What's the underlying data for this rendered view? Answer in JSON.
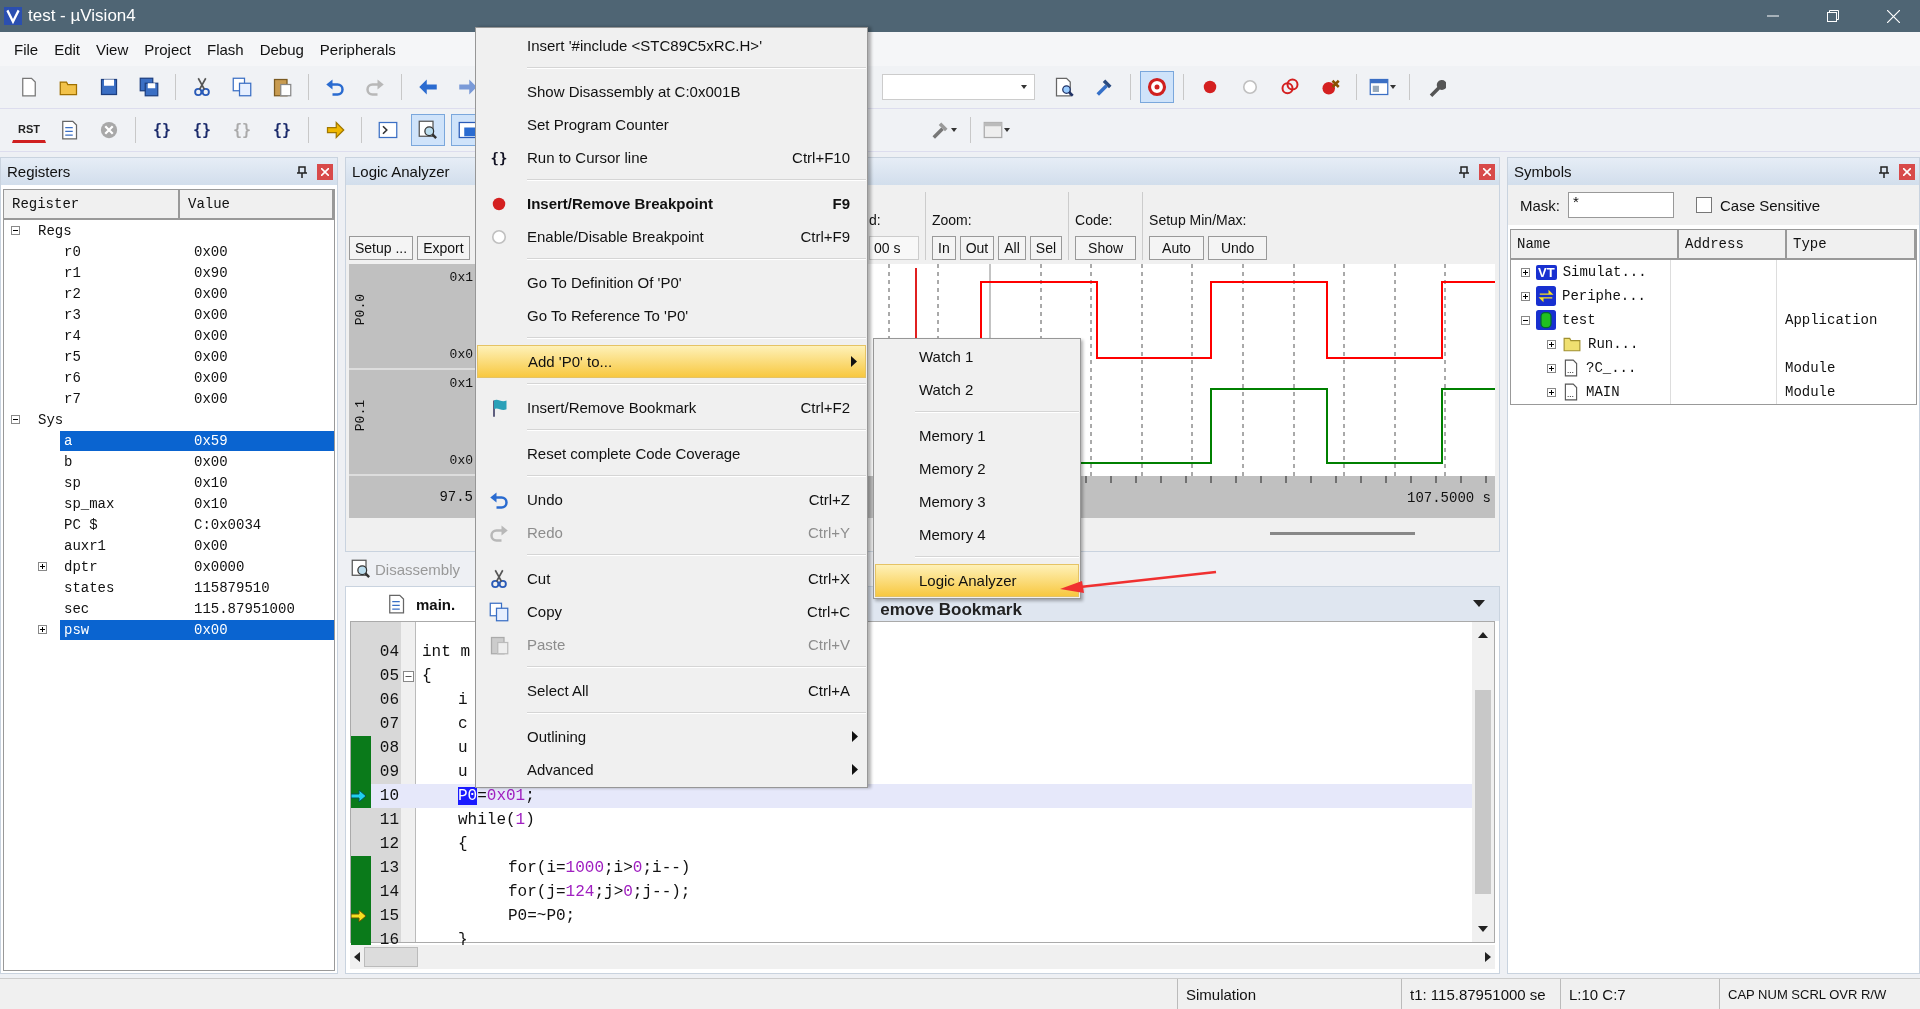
{
  "window": {
    "title": "test  - µVision4"
  },
  "menu_bar": [
    "File",
    "Edit",
    "View",
    "Project",
    "Flash",
    "Debug",
    "Peripherals"
  ],
  "debug_toolbar": {
    "reset_label": "RST",
    "step_glyphs": [
      "{}",
      "{}",
      "{}",
      "{}"
    ]
  },
  "registers": {
    "title": "Registers",
    "columns": [
      "Register",
      "Value"
    ],
    "groups": [
      {
        "name": "Regs",
        "expanded": true,
        "children": [
          {
            "name": "r0",
            "value": "0x00",
            "kind": "leaf",
            "selected": false
          },
          {
            "name": "r1",
            "value": "0x90",
            "kind": "leaf",
            "selected": false
          },
          {
            "name": "r2",
            "value": "0x00",
            "kind": "leaf",
            "selected": false
          },
          {
            "name": "r3",
            "value": "0x00",
            "kind": "leaf",
            "selected": false
          },
          {
            "name": "r4",
            "value": "0x00",
            "kind": "leaf",
            "selected": false
          },
          {
            "name": "r5",
            "value": "0x00",
            "kind": "leaf",
            "selected": false
          },
          {
            "name": "r6",
            "value": "0x00",
            "kind": "leaf",
            "selected": false
          },
          {
            "name": "r7",
            "value": "0x00",
            "kind": "leaf",
            "selected": false
          }
        ]
      },
      {
        "name": "Sys",
        "expanded": true,
        "children": [
          {
            "name": "a",
            "value": "0x59",
            "kind": "leaf",
            "selected": true
          },
          {
            "name": "b",
            "value": "0x00",
            "kind": "leaf",
            "selected": false
          },
          {
            "name": "sp",
            "value": "0x10",
            "kind": "leaf",
            "selected": false
          },
          {
            "name": "sp_max",
            "value": "0x10",
            "kind": "leaf",
            "selected": false
          },
          {
            "name": "PC  $",
            "value": "C:0x0034",
            "kind": "leaf",
            "selected": false
          },
          {
            "name": "auxr1",
            "value": "0x00",
            "kind": "leaf",
            "selected": false
          },
          {
            "name": "dptr",
            "value": "0x0000",
            "kind": "collapsed",
            "selected": false
          },
          {
            "name": "states",
            "value": "115879510",
            "kind": "leaf",
            "selected": false
          },
          {
            "name": "sec",
            "value": "115.87951000",
            "kind": "leaf",
            "selected": false
          },
          {
            "name": "psw",
            "value": "0x00",
            "kind": "collapsed",
            "selected": true
          }
        ]
      }
    ]
  },
  "logic_analyzer": {
    "title": "Logic Analyzer",
    "buttons": [
      "Setup ...",
      "Export"
    ],
    "range_label": "d:",
    "range_value": "00 s",
    "zoom_label": "Zoom:",
    "zoom_buttons": [
      "In",
      "Out",
      "All",
      "Sel"
    ],
    "code_label": "Code:",
    "code_buttons": [
      "Show"
    ],
    "minmax_label": "Setup Min/Max:",
    "minmax_buttons": [
      "Auto",
      "Undo"
    ],
    "signals": [
      {
        "name": "P0.0",
        "max": "0x1",
        "min": "0x0",
        "color": "#ff0000"
      },
      {
        "name": "P0.1",
        "max": "0x1",
        "min": "0x0",
        "color": "#008000"
      }
    ],
    "time_start": "97.5",
    "time_end": "107.5000 s"
  },
  "editor": {
    "tabs": [
      {
        "label": "Disassembly",
        "selected": false
      },
      {
        "label": "main.",
        "selected": true
      }
    ],
    "tooltip_fragment": "emove Bookmark",
    "lines": [
      {
        "number": "04",
        "kind": "top",
        "covered": false,
        "cursor_arrow": false,
        "pc_arrow": false,
        "segments": [
          {
            "text": "int m",
            "kind": "plain"
          }
        ]
      },
      {
        "number": "05",
        "kind": "top",
        "covered": false,
        "cursor_arrow": false,
        "pc_arrow": false,
        "fold": true,
        "segments": [
          {
            "text": "{",
            "kind": "plain"
          }
        ]
      },
      {
        "number": "06",
        "kind": "body",
        "covered": false,
        "cursor_arrow": false,
        "pc_arrow": false,
        "segments": [
          {
            "text": "i",
            "kind": "plain"
          }
        ]
      },
      {
        "number": "07",
        "kind": "body",
        "covered": false,
        "cursor_arrow": false,
        "pc_arrow": false,
        "segments": [
          {
            "text": "c",
            "kind": "plain"
          }
        ]
      },
      {
        "number": "08",
        "kind": "body",
        "covered": true,
        "cursor_arrow": false,
        "pc_arrow": false,
        "segments": [
          {
            "text": "u",
            "kind": "plain"
          }
        ]
      },
      {
        "number": "09",
        "kind": "body",
        "covered": true,
        "cursor_arrow": false,
        "pc_arrow": false,
        "segments": [
          {
            "text": "u",
            "kind": "plain"
          }
        ]
      },
      {
        "number": "10",
        "kind": "body",
        "covered": true,
        "cursor_arrow": true,
        "pc_arrow": false,
        "segments": [
          {
            "text": "P0",
            "kind": "selected"
          },
          {
            "text": "=",
            "kind": "plain"
          },
          {
            "text": "0x01",
            "kind": "number"
          },
          {
            "text": ";",
            "kind": "plain"
          }
        ]
      },
      {
        "number": "11",
        "kind": "body",
        "covered": false,
        "cursor_arrow": false,
        "pc_arrow": false,
        "segments": [
          {
            "text": "while(",
            "kind": "plain"
          },
          {
            "text": "1",
            "kind": "number"
          },
          {
            "text": ")",
            "kind": "plain"
          }
        ]
      },
      {
        "number": "12",
        "kind": "body",
        "covered": false,
        "cursor_arrow": false,
        "pc_arrow": false,
        "segments": [
          {
            "text": "{",
            "kind": "plain"
          }
        ]
      },
      {
        "number": "13",
        "kind": "loop",
        "covered": true,
        "cursor_arrow": false,
        "pc_arrow": false,
        "segments": [
          {
            "text": "for(i=",
            "kind": "plain"
          },
          {
            "text": "1000",
            "kind": "number"
          },
          {
            "text": ";i>",
            "kind": "plain"
          },
          {
            "text": "0",
            "kind": "number"
          },
          {
            "text": ";i--)",
            "kind": "plain"
          }
        ]
      },
      {
        "number": "14",
        "kind": "loop",
        "covered": true,
        "cursor_arrow": false,
        "pc_arrow": false,
        "segments": [
          {
            "text": "for(j=",
            "kind": "plain"
          },
          {
            "text": "124",
            "kind": "number"
          },
          {
            "text": ";j>",
            "kind": "plain"
          },
          {
            "text": "0",
            "kind": "number"
          },
          {
            "text": ";j--);",
            "kind": "plain"
          }
        ]
      },
      {
        "number": "15",
        "kind": "loop",
        "covered": true,
        "cursor_arrow": false,
        "pc_arrow": true,
        "segments": [
          {
            "text": "P0=~P0;",
            "kind": "plain"
          }
        ]
      },
      {
        "number": "16",
        "kind": "body",
        "covered": true,
        "cursor_arrow": false,
        "pc_arrow": false,
        "segments": [
          {
            "text": "}",
            "kind": "plain"
          }
        ]
      }
    ]
  },
  "symbols": {
    "title": "Symbols",
    "mask_label": "Mask:",
    "mask_value": "*",
    "case_sensitive": {
      "label": "Case Sensitive",
      "checked": false
    },
    "columns": [
      "Name",
      "Address",
      "Type"
    ],
    "tree": [
      {
        "name": "Simulat...",
        "kind": "vt",
        "icon_text": "VT",
        "expanded": false
      },
      {
        "name": "Periphe...",
        "kind": "peripherals",
        "expanded": false
      },
      {
        "name": "test",
        "type": "Application",
        "kind": "application",
        "expanded": true,
        "children": [
          {
            "name": "Run...",
            "kind": "folder",
            "expanded": false
          },
          {
            "name": "?C_...",
            "type": "Module",
            "kind": "module",
            "expanded": false
          },
          {
            "name": "MAIN",
            "type": "Module",
            "kind": "module",
            "expanded": false
          }
        ]
      }
    ]
  },
  "status_bar": [
    "Simulation",
    "t1: 115.87951000 se",
    "L:10 C:7",
    "CAP NUM SCRL OVR R/W"
  ],
  "context_menu": [
    {
      "kind": "item",
      "label": "Insert '#include <STC89C5xRC.H>'",
      "selected": false,
      "disabled": false,
      "default": false
    },
    {
      "kind": "separator"
    },
    {
      "kind": "item",
      "label": "Show Disassembly at C:0x001B",
      "selected": false,
      "disabled": false,
      "default": false
    },
    {
      "kind": "item",
      "label": "Set Program Counter",
      "selected": false,
      "disabled": false,
      "default": false
    },
    {
      "kind": "item",
      "label": "Run to Cursor line",
      "shortcut": "Ctrl+F10",
      "glyph": "{}",
      "selected": false,
      "disabled": false,
      "default": false
    },
    {
      "kind": "separator"
    },
    {
      "kind": "item",
      "label": "Insert/Remove Breakpoint",
      "shortcut": "F9",
      "selected": false,
      "disabled": false,
      "default": true
    },
    {
      "kind": "item",
      "label": "Enable/Disable Breakpoint",
      "shortcut": "Ctrl+F9",
      "selected": false,
      "disabled": false,
      "default": false
    },
    {
      "kind": "separator"
    },
    {
      "kind": "item",
      "label": "Go To Definition Of 'P0'",
      "selected": false,
      "disabled": false,
      "default": false
    },
    {
      "kind": "item",
      "label": "Go To Reference To 'P0'",
      "selected": false,
      "disabled": false,
      "default": false
    },
    {
      "kind": "separator"
    },
    {
      "kind": "submenu",
      "label": "Add 'P0' to...",
      "selected": true,
      "disabled": false,
      "default": false
    },
    {
      "kind": "separator"
    },
    {
      "kind": "item",
      "label": "Insert/Remove Bookmark",
      "shortcut": "Ctrl+F2",
      "selected": false,
      "disabled": false,
      "default": false
    },
    {
      "kind": "separator"
    },
    {
      "kind": "item",
      "label": "Reset complete Code Coverage",
      "selected": false,
      "disabled": false,
      "default": false
    },
    {
      "kind": "separator"
    },
    {
      "kind": "item",
      "label": "Undo",
      "shortcut": "Ctrl+Z",
      "selected": false,
      "disabled": false,
      "default": false
    },
    {
      "kind": "item",
      "label": "Redo",
      "shortcut": "Ctrl+Y",
      "selected": false,
      "disabled": true,
      "default": false
    },
    {
      "kind": "separator"
    },
    {
      "kind": "item",
      "label": "Cut",
      "shortcut": "Ctrl+X",
      "selected": false,
      "disabled": false,
      "default": false
    },
    {
      "kind": "item",
      "label": "Copy",
      "shortcut": "Ctrl+C",
      "selected": false,
      "disabled": false,
      "default": false
    },
    {
      "kind": "item",
      "label": "Paste",
      "shortcut": "Ctrl+V",
      "selected": false,
      "disabled": true,
      "default": false
    },
    {
      "kind": "separator"
    },
    {
      "kind": "item",
      "label": "Select All",
      "shortcut": "Ctrl+A",
      "selected": false,
      "disabled": false,
      "default": false
    },
    {
      "kind": "separator"
    },
    {
      "kind": "submenu",
      "label": "Outlining",
      "selected": false,
      "disabled": false,
      "default": false
    },
    {
      "kind": "submenu",
      "label": "Advanced",
      "selected": false,
      "disabled": false,
      "default": false
    }
  ],
  "submenu": [
    {
      "kind": "item",
      "label": "Watch 1",
      "selected": false
    },
    {
      "kind": "item",
      "label": "Watch 2",
      "selected": false
    },
    {
      "kind": "separator"
    },
    {
      "kind": "item",
      "label": "Memory 1",
      "selected": false
    },
    {
      "kind": "item",
      "label": "Memory 2",
      "selected": false
    },
    {
      "kind": "item",
      "label": "Memory 3",
      "selected": false
    },
    {
      "kind": "item",
      "label": "Memory 4",
      "selected": false
    },
    {
      "kind": "separator"
    },
    {
      "kind": "item",
      "label": "Logic Analyzer",
      "selected": true
    }
  ]
}
